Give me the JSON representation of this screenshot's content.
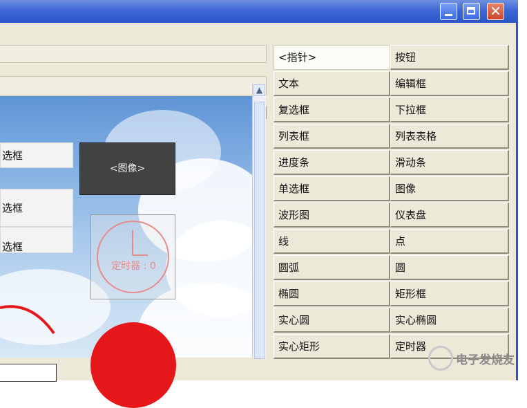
{
  "window": {
    "controls": [
      "minimize",
      "maximize",
      "close"
    ],
    "close_glyph": "✕"
  },
  "canvas": {
    "items": [
      {
        "label": "选框"
      },
      {
        "label": "选框"
      },
      {
        "label": "选框"
      }
    ],
    "image_placeholder": "<图像>",
    "timer_label": "定时器 : 0"
  },
  "scrollbar": {
    "up_arrow": "▲"
  },
  "palette": {
    "rows": [
      {
        "left": "<指针>",
        "right": "按钮"
      },
      {
        "left": "文本",
        "right": "编辑框"
      },
      {
        "left": "复选框",
        "right": "下拉框"
      },
      {
        "left": "列表框",
        "right": "列表表格"
      },
      {
        "left": "进度条",
        "right": "滑动条"
      },
      {
        "left": "单选框",
        "right": "图像"
      },
      {
        "left": "波形图",
        "right": "仪表盘"
      },
      {
        "left": "线",
        "right": "点"
      },
      {
        "left": "圆弧",
        "right": "圆"
      },
      {
        "left": "椭圆",
        "right": "矩形框"
      },
      {
        "left": "实心圆",
        "right": "实心椭圆"
      },
      {
        "left": "实心矩形",
        "right": "定时器"
      }
    ],
    "selected": "<指针>"
  },
  "watermark": {
    "text": "电子发烧友"
  },
  "colors": {
    "title_bar": "#3e68d6",
    "panel": "#ece9d8",
    "red": "#e5171a",
    "timer": "#e88b8b"
  }
}
